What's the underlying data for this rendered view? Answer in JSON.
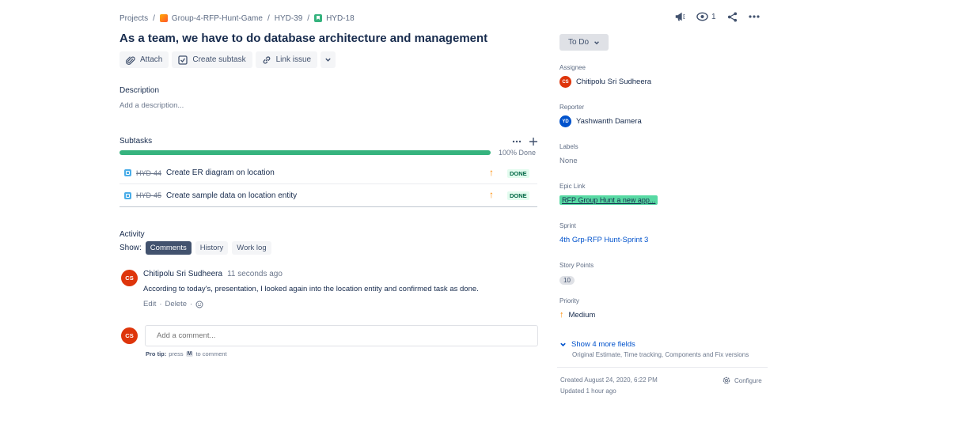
{
  "breadcrumb": {
    "projects": "Projects",
    "project": "Group-4-RFP-Hunt-Game",
    "epic": "HYD-39",
    "issue": "HYD-18",
    "sep": "/"
  },
  "toolbar": {
    "watch_count": "1"
  },
  "issue": {
    "title": "As a team, we have to do database architecture and management"
  },
  "actions": {
    "attach": "Attach",
    "create_subtask": "Create subtask",
    "link_issue": "Link issue"
  },
  "description": {
    "label": "Description",
    "placeholder": "Add a description..."
  },
  "subtasks": {
    "label": "Subtasks",
    "progress_fraction": 1.0,
    "progress_label": "100% Done",
    "items": [
      {
        "key": "HYD-44",
        "summary": "Create ER diagram on location",
        "status": "DONE"
      },
      {
        "key": "HYD-45",
        "summary": "Create sample data on location entity",
        "status": "DONE"
      }
    ]
  },
  "activity": {
    "label": "Activity",
    "show_label": "Show:",
    "tabs": [
      "Comments",
      "History",
      "Work log"
    ],
    "comment": {
      "avatar": "CS",
      "author": "Chitipolu Sri Sudheera",
      "time": "11 seconds ago",
      "body": "According to today's, presentation, I looked again into the location entity and confirmed task as done.",
      "edit": "Edit",
      "delete": "Delete",
      "dot": "·"
    },
    "new_comment": {
      "avatar": "CS",
      "placeholder": "Add a comment...",
      "tip_label": "Pro tip:",
      "tip_press": "press",
      "tip_key": "M",
      "tip_rest": "to comment"
    }
  },
  "sidebar": {
    "status": "To Do",
    "assignee": {
      "label": "Assignee",
      "initials": "CS",
      "name": "Chitipolu Sri Sudheera"
    },
    "reporter": {
      "label": "Reporter",
      "initials": "YD",
      "name": "Yashwanth Damera"
    },
    "labels": {
      "label": "Labels",
      "value": "None"
    },
    "epic": {
      "label": "Epic Link",
      "value": "RFP Group Hunt a new app..."
    },
    "sprint": {
      "label": "Sprint",
      "value": "4th Grp-RFP Hunt-Sprint 3"
    },
    "story_points": {
      "label": "Story Points",
      "value": "10"
    },
    "priority": {
      "label": "Priority",
      "value": "Medium"
    },
    "more_fields": {
      "label": "Show 4 more fields",
      "sub": "Original Estimate, Time tracking, Components and Fix versions"
    },
    "created": "Created August 24, 2020, 6:22 PM",
    "updated": "Updated 1 hour ago",
    "configure": "Configure"
  },
  "colors": {
    "progress": "#36b37e",
    "priority_medium": "#ff8b00",
    "avatar_cs": "#de350b",
    "avatar_yd": "#0052cc",
    "epic": "#57d9a3"
  }
}
